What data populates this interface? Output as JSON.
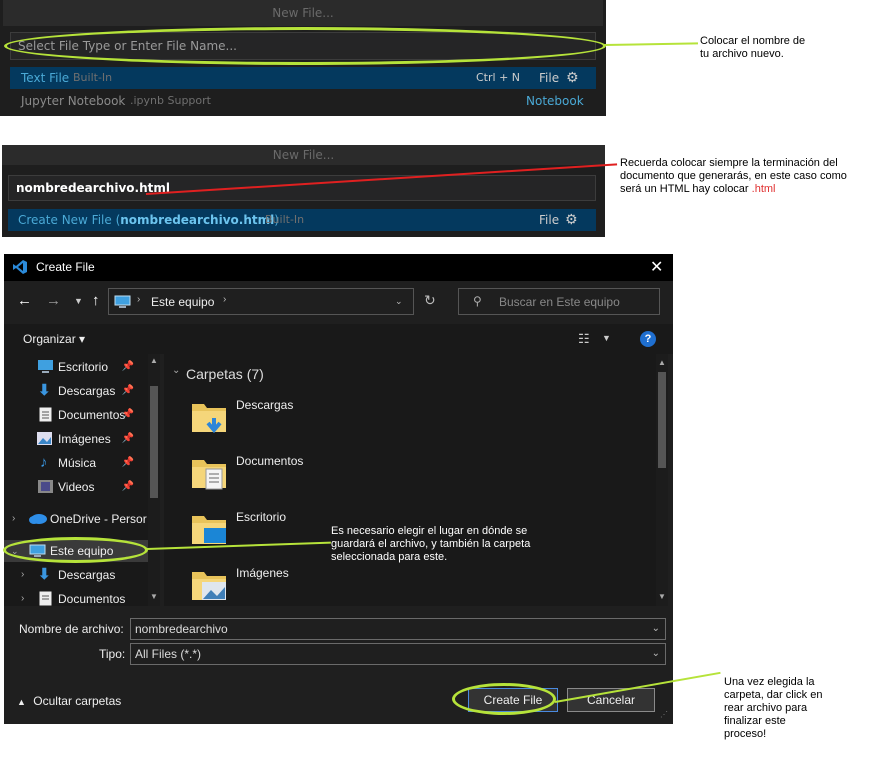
{
  "panel1": {
    "title": "New File...",
    "placeholder": "Select File Type or Enter File Name...",
    "row1_label": "Text File",
    "row1_source": "Built-In",
    "row1_shortcut": "Ctrl + N",
    "row1_type": "File",
    "row2_label": "Jupyter Notebook",
    "row2_source": ".ipynb Support",
    "row2_type": "Notebook"
  },
  "note1": {
    "line1": "Colocar el nombre de",
    "line2": "tu archivo nuevo."
  },
  "panel2": {
    "title": "New File...",
    "input_value": "nombredearchivo.html",
    "row1_prefix": "Create New File (",
    "row1_name": "nombredearchivo.html",
    "row1_suffix": ")",
    "row1_source": "Built-In",
    "row1_type": "File"
  },
  "note2": {
    "line1": "Recuerda colocar siempre la terminación del",
    "line2": "documento que generarás, en este caso como",
    "line3_prefix": "será un HTML hay colocar ",
    "line3_ext": ".html"
  },
  "dialog": {
    "title": "Create File",
    "address": "Este equipo",
    "search_placeholder": "Buscar en Este equipo",
    "organize": "Organizar",
    "help": "?",
    "nav_items": [
      {
        "label": "Escritorio"
      },
      {
        "label": "Descargas"
      },
      {
        "label": "Documentos"
      },
      {
        "label": "Imágenes"
      },
      {
        "label": "Música"
      },
      {
        "label": "Videos"
      },
      {
        "label": "OneDrive - Persor"
      },
      {
        "label": "Este equipo"
      },
      {
        "label": "Descargas"
      },
      {
        "label": "Documentos"
      }
    ],
    "section_header": "Carpetas (7)",
    "folders": [
      {
        "label": "Descargas"
      },
      {
        "label": "Documentos"
      },
      {
        "label": "Escritorio"
      },
      {
        "label": "Imágenes"
      }
    ],
    "filename_label": "Nombre de archivo:",
    "filename_value": "nombredearchivo",
    "type_label": "Tipo:",
    "type_value": "All Files (*.*)",
    "hide_folders": "Ocultar carpetas",
    "create_button": "Create File",
    "cancel_button": "Cancelar"
  },
  "note3": {
    "line1": "Es necesario elegir el lugar en dónde se",
    "line2": "guardará el archivo, y también la carpeta",
    "line3": "seleccionada para este."
  },
  "note4": {
    "line1": "Una vez elegida la",
    "line2": "carpeta, dar click en",
    "line3": "rear archivo para",
    "line4": "finalizar este",
    "line5": "proceso!"
  }
}
